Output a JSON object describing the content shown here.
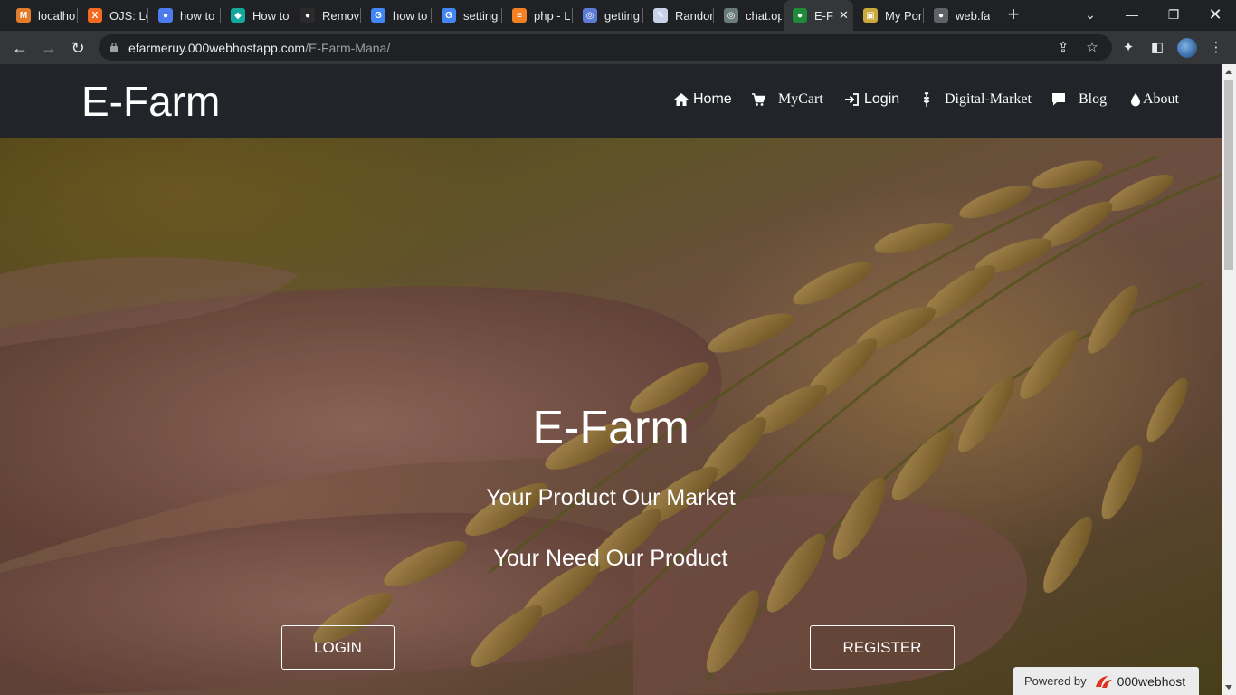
{
  "browser": {
    "tabs": [
      {
        "title": "localho",
        "fav_color": "#e37c2a",
        "fav_glyph": "M"
      },
      {
        "title": "OJS: Lo",
        "fav_color": "#f26b21",
        "fav_glyph": "X"
      },
      {
        "title": "how to",
        "fav_color": "#4b7bec",
        "fav_glyph": "●"
      },
      {
        "title": "How to",
        "fav_color": "#13a89e",
        "fav_glyph": "◆"
      },
      {
        "title": "Remov",
        "fav_color": "#2b2b2b",
        "fav_glyph": "●"
      },
      {
        "title": "how to",
        "fav_color": "#4285f4",
        "fav_glyph": "G"
      },
      {
        "title": "setting",
        "fav_color": "#4285f4",
        "fav_glyph": "G"
      },
      {
        "title": "php - L",
        "fav_color": "#f48024",
        "fav_glyph": "≡"
      },
      {
        "title": "getting",
        "fav_color": "#5b7bd5",
        "fav_glyph": "◎"
      },
      {
        "title": "Randor",
        "fav_color": "#c9d1e8",
        "fav_glyph": "✎"
      },
      {
        "title": "chat.op",
        "fav_color": "#6b7d7a",
        "fav_glyph": "◎"
      },
      {
        "title": "E-F",
        "fav_color": "#1f8a3a",
        "fav_glyph": "●"
      },
      {
        "title": "My Por",
        "fav_color": "#c9a93b",
        "fav_glyph": "▣"
      },
      {
        "title": "web.fa",
        "fav_color": "#5f6368",
        "fav_glyph": "●"
      }
    ],
    "new_tab": "+",
    "url_host": "efarmeruy.000webhostapp.com",
    "url_path": "/E-Farm-Mana/"
  },
  "page": {
    "brand": "E-Farm",
    "nav": [
      {
        "label": "Home",
        "icon": "home-icon"
      },
      {
        "label": "MyCart",
        "icon": "cart-icon"
      },
      {
        "label": "Login",
        "icon": "login-icon"
      },
      {
        "label": "Digital-Market",
        "icon": "plant-icon"
      },
      {
        "label": "Blog",
        "icon": "comment-icon"
      },
      {
        "label": "About",
        "icon": "drop-icon"
      }
    ],
    "hero": {
      "title": "E-Farm",
      "subtitle1": "Your Product Our Market",
      "subtitle2": "Your Need Our Product",
      "login_button": "LOGIN",
      "register_button": "REGISTER"
    },
    "powered": {
      "prefix": "Powered by",
      "brand": "000webhost"
    }
  }
}
